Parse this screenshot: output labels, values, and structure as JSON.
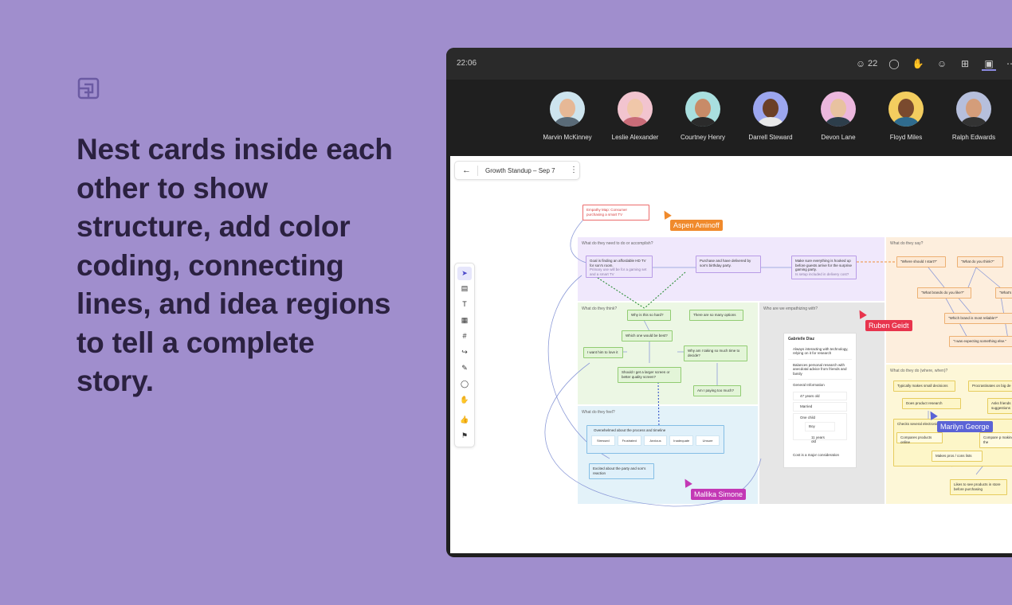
{
  "headline": "Nest cards inside each other to show structure, add color coding, connecting lines, and idea regions to tell a complete story.",
  "topbar": {
    "time": "22:06",
    "participants_count": "22"
  },
  "participants": [
    {
      "name": "Marvin McKinney",
      "bg": "#cde4ee",
      "skin": "#e6b896",
      "shirt": "#5a6b78"
    },
    {
      "name": "Leslie Alexander",
      "bg": "#f2c4cf",
      "skin": "#f0c7a9",
      "shirt": "#c96c78"
    },
    {
      "name": "Courtney Henry",
      "bg": "#a9dfdf",
      "skin": "#c88b68",
      "shirt": "#2b2b2b"
    },
    {
      "name": "Darrell Steward",
      "bg": "#9ca6ef",
      "skin": "#6b3f26",
      "shirt": "#e8e8e8"
    },
    {
      "name": "Devon Lane",
      "bg": "#ecb7dd",
      "skin": "#e8c2a0",
      "shirt": "#2d3e4b"
    },
    {
      "name": "Floyd Miles",
      "bg": "#f3cd5f",
      "skin": "#7a4a2e",
      "shirt": "#2f6b8e"
    },
    {
      "name": "Ralph Edwards",
      "bg": "#b6bfdc",
      "skin": "#d49d7a",
      "shirt": "#333"
    }
  ],
  "board": {
    "title": "Growth Standup – Sep 7",
    "empathy_map": "Empathy Map: Consumer purchasing a smart TV",
    "regions": {
      "need": "What do they need to do or accomplish?",
      "say": "What do they say?",
      "think": "What do they think?",
      "who": "Who are we empathizing with?",
      "do": "What do they do (where, when)?",
      "feel": "What do they feel?"
    },
    "need_cards": [
      "Goal is finding an affordable HD TV for son's room.",
      "Purchase and have delivered by son's birthday party.",
      "Make sure everything is hooked up before guests arrive for the surprise gaming party."
    ],
    "need_sub": "Primary use will be for a gaming set and a smart TV",
    "need_sub2": "Is setup included in delivery cost?",
    "say_cards": [
      "\"Where should I start?\"",
      "\"What do you think?\"",
      "\"What brands do you like?\"",
      "\"What's t",
      "\"Which brand is most reliable?\"",
      "\"I was expecting something else.\""
    ],
    "think_cards": [
      "Why is this so hard?",
      "There are so many options",
      "Which one would be best?",
      "I want him to love it",
      "Why am I taking so much time to decide?",
      "Should I get a larger screen or better quality screen?",
      "Am I paying too much?"
    ],
    "persona": {
      "name": "Gabrielle Diaz",
      "lines": [
        "Always interacting with technology, relying on it for research",
        "Balances personal research with anecdotal advice from friends and family"
      ],
      "info_title": "General Information",
      "info": [
        "47 years old",
        "Married",
        "One child",
        "Boy",
        "11 years old"
      ],
      "footer": "Cost is a major consideration"
    },
    "do_cards": [
      "Typically makes small decisions",
      "Procrastinates on big de",
      "Does product research",
      "Asks friends suggestions",
      "Checks several electronic",
      "Compares products online",
      "Compare p making the",
      "Makes pros / cons lists",
      "Likes to see products in store before purchasing"
    ],
    "feel_group": "Overwhelmed about the process and timeline",
    "feel_chips": [
      "Stressed",
      "Frustrated",
      "Anxious",
      "Inadequate",
      "Unsure"
    ],
    "feel_card": "Excited about the party and son's reaction"
  },
  "cursors": [
    {
      "name": "Aspen Aminoff",
      "color": "#f08a2c"
    },
    {
      "name": "Ruben Geidt",
      "color": "#e8344d"
    },
    {
      "name": "Marilyn George",
      "color": "#5b63d6"
    },
    {
      "name": "Mallika Simone",
      "color": "#c338b5"
    }
  ]
}
